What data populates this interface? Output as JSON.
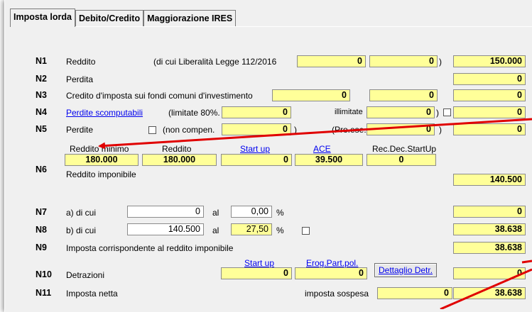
{
  "tabs": [
    "Imposta lorda",
    "Debito/Credito",
    "Maggiorazione IRES"
  ],
  "rows": {
    "n1": {
      "code": "N1",
      "label": "Reddito",
      "note": "(di cui Liberalità Legge 112/2016",
      "v1": "0",
      "v2": "0",
      "close": ")",
      "total": "150.000"
    },
    "n2": {
      "code": "N2",
      "label": "Perdita",
      "total": "0"
    },
    "n3": {
      "code": "N3",
      "label": "Credito d'imposta sui fondi comuni d'investimento",
      "v1": "0",
      "v2": "0",
      "total": "0"
    },
    "n4": {
      "code": "N4",
      "label": "Perdite scomputabili",
      "note": "(limitate 80%.",
      "v1": "0",
      "illimitate": "illimitate",
      "v2": "0",
      "close": ")",
      "total": "0"
    },
    "n5": {
      "code": "N5",
      "label": "Perdite",
      "note": "(non compen.",
      "v1": "0",
      "close": ")",
      "proese": "(Pro.ese.",
      "v2": "0",
      "close2": ")",
      "total": "0"
    },
    "n6": {
      "code": "N6",
      "h_minimo": "Reddito minimo",
      "h_reddito": "Reddito",
      "h_startup": "Start up",
      "h_ace": "ACE",
      "h_recdec": "Rec.Dec.StartUp",
      "v_minimo": "180.000",
      "v_reddito": "180.000",
      "v_startup": "0",
      "v_ace": "39.500",
      "v_recdec": "0",
      "imponibile_label": "Reddito imponibile",
      "imponibile": "140.500"
    },
    "n7": {
      "code": "N7",
      "label": "a) di cui",
      "amount": "0",
      "al": "al",
      "pct": "0,00",
      "pct_sign": "%",
      "total": "0"
    },
    "n8": {
      "code": "N8",
      "label": "b) di cui",
      "amount": "140.500",
      "al": "al",
      "pct": "27,50",
      "pct_sign": "%",
      "total": "38.638"
    },
    "n9": {
      "code": "N9",
      "label": "Imposta corrispondente al reddito imponibile",
      "total": "38.638"
    },
    "n10": {
      "code": "N10",
      "label": "Detrazioni",
      "h_startup": "Start up",
      "h_erog": "Erog.Part.pol.",
      "v_startup": "0",
      "v_erog": "0",
      "button": "Dettaglio Detr.",
      "total": "0"
    },
    "n11": {
      "code": "N11",
      "label": "Imposta netta",
      "sospesa_label": "imposta sospesa",
      "sospesa": "0",
      "total": "38.638"
    }
  },
  "colors": {
    "field": "#ffff99",
    "arrow": "#e00000",
    "link": "#0000ee"
  }
}
